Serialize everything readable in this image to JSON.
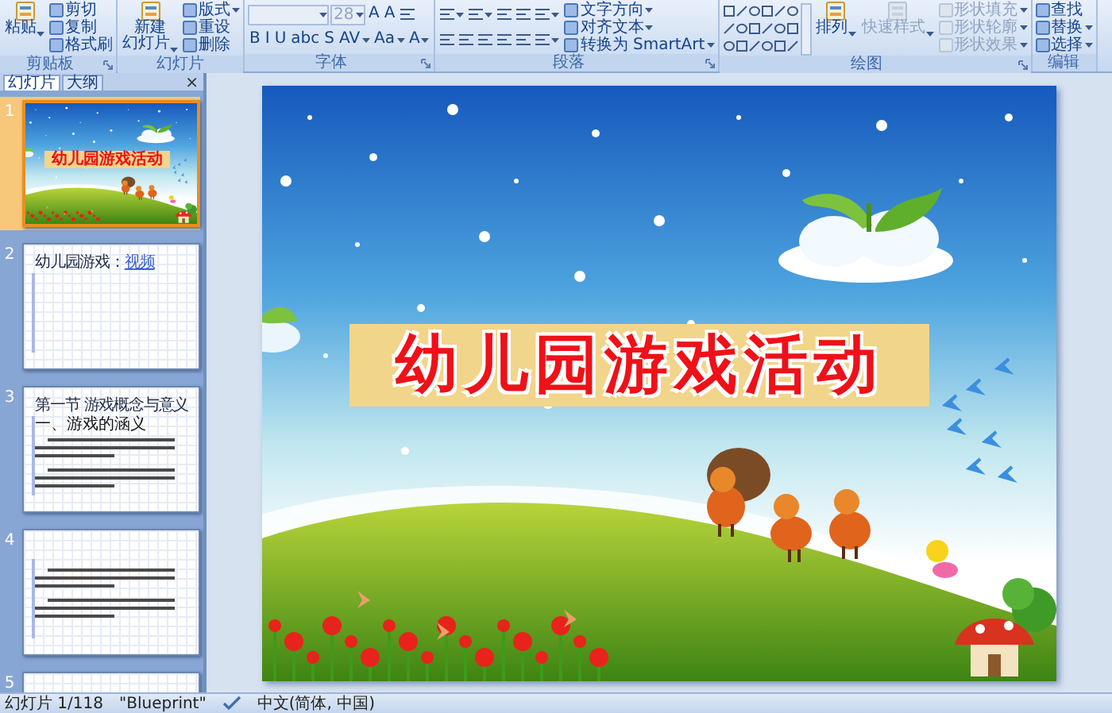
{
  "ribbon": {
    "groups": [
      {
        "label": "剪贴板",
        "launcher": true,
        "columns": [
          [
            [
              {
                "kind": "large",
                "label": "粘贴",
                "dropdown": true
              }
            ]
          ],
          [
            [
              {
                "kind": "small",
                "label": "剪切"
              }
            ],
            [
              {
                "kind": "small",
                "label": "复制"
              }
            ],
            [
              {
                "kind": "small",
                "label": "格式刷"
              }
            ]
          ]
        ]
      },
      {
        "label": "幻灯片",
        "launcher": false,
        "columns": [
          [
            [
              {
                "kind": "large",
                "label": "新建",
                "label_line2": "幻灯片",
                "dropdown": true
              }
            ]
          ],
          [
            [
              {
                "kind": "small",
                "label": "版式",
                "dropdown": true
              }
            ],
            [
              {
                "kind": "small",
                "label": "重设"
              }
            ],
            [
              {
                "kind": "small",
                "label": "删除"
              }
            ]
          ]
        ]
      },
      {
        "label": "字体",
        "launcher": true,
        "columns": [
          [
            [
              {
                "kind": "field",
                "disabled": true
              },
              {
                "kind": "sizefield",
                "value": "28",
                "disabled": true
              },
              {
                "kind": "glyph",
                "label": "A"
              },
              {
                "kind": "glyph",
                "label": "A"
              },
              {
                "kind": "icon"
              }
            ],
            [
              {
                "kind": "glyph",
                "label": "B"
              },
              {
                "kind": "glyph",
                "label": "I"
              },
              {
                "kind": "glyph",
                "label": "U"
              },
              {
                "kind": "glyph",
                "label": "abc"
              },
              {
                "kind": "glyph",
                "label": "S"
              },
              {
                "kind": "glyph",
                "label": "AV",
                "dropdown": true
              },
              {
                "kind": "glyph",
                "label": "Aa",
                "dropdown": true
              },
              {
                "kind": "glyph",
                "label": "A",
                "dropdown": true
              }
            ]
          ]
        ]
      },
      {
        "label": "段落",
        "launcher": true,
        "columns": [
          [
            [
              {
                "kind": "icon",
                "dropdown": true
              },
              {
                "kind": "icon",
                "dropdown": true
              },
              {
                "kind": "icon"
              },
              {
                "kind": "icon"
              },
              {
                "kind": "icon",
                "dropdown": true
              }
            ],
            [
              {
                "kind": "icon"
              },
              {
                "kind": "icon"
              },
              {
                "kind": "icon"
              },
              {
                "kind": "icon"
              },
              {
                "kind": "icon"
              },
              {
                "kind": "icon",
                "dropdown": true
              }
            ]
          ],
          [
            [
              {
                "kind": "small",
                "label": "文字方向",
                "dropdown": true
              }
            ],
            [
              {
                "kind": "small",
                "label": "对齐文本",
                "dropdown": true
              }
            ],
            [
              {
                "kind": "small",
                "label": "转换为 SmartArt",
                "dropdown": true
              }
            ]
          ]
        ]
      },
      {
        "label": "绘图",
        "launcher": true,
        "columns": [
          [
            [
              {
                "kind": "gallery"
              }
            ]
          ],
          [
            [
              {
                "kind": "large",
                "label": "排列",
                "dropdown": true
              }
            ]
          ],
          [
            [
              {
                "kind": "large",
                "label": "快速样式",
                "dropdown": true,
                "disabled": true
              }
            ]
          ],
          [
            [
              {
                "kind": "small",
                "label": "形状填充",
                "dropdown": true,
                "disabled": true
              }
            ],
            [
              {
                "kind": "small",
                "label": "形状轮廓",
                "dropdown": true,
                "disabled": true
              }
            ],
            [
              {
                "kind": "small",
                "label": "形状效果",
                "dropdown": true,
                "disabled": true
              }
            ]
          ]
        ]
      },
      {
        "label": "编辑",
        "launcher": false,
        "columns": [
          [
            [
              {
                "kind": "small",
                "label": "查找"
              }
            ],
            [
              {
                "kind": "small",
                "label": "替换",
                "dropdown": true
              }
            ],
            [
              {
                "kind": "small",
                "label": "选择",
                "dropdown": true
              }
            ]
          ]
        ]
      }
    ]
  },
  "panel": {
    "tabs": [
      {
        "label": "幻灯片",
        "selected": true
      },
      {
        "label": "大纲",
        "selected": false
      }
    ],
    "close": "×",
    "thumbnails": [
      {
        "number": "1",
        "selected": true,
        "kind": "title",
        "title": "幼儿园游戏活动"
      },
      {
        "number": "2",
        "selected": false,
        "kind": "content",
        "title": "幼儿园游戏：",
        "link": "视频"
      },
      {
        "number": "3",
        "selected": false,
        "kind": "content",
        "title": "第一节 游戏概念与意义",
        "subtitle": "一、游戏的涵义",
        "body_text": true
      },
      {
        "number": "4",
        "selected": false,
        "kind": "content",
        "body_text": true
      },
      {
        "number": "5",
        "selected": false,
        "kind": "content"
      }
    ]
  },
  "slide": {
    "title": "幼儿园游戏活动"
  },
  "status_bar": {
    "items": [
      {
        "kind": "text",
        "label": "幻灯片 1/118"
      },
      {
        "kind": "text",
        "label": "\"Blueprint\""
      },
      {
        "kind": "spellcheck"
      },
      {
        "kind": "text",
        "label": "中文(简体, 中国)"
      }
    ]
  }
}
